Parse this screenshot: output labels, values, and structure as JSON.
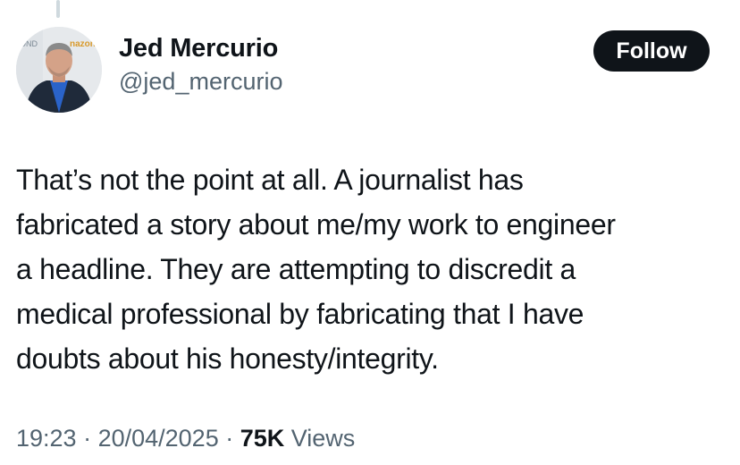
{
  "author": {
    "display_name": "Jed Mercurio",
    "handle": "@jed_mercurio",
    "avatar": "avatar-photo",
    "avatar_backdrop_text": [
      "YOND",
      "nazon"
    ]
  },
  "follow_button": {
    "label": "Follow"
  },
  "tweet": {
    "text": "That’s not the point at all. A journalist has\nfabricated a story about me/my work to engineer\na headline. They are attempting to discredit a\nmedical professional by fabricating that I have\ndoubts about his honesty/integrity."
  },
  "meta": {
    "time": "19:23",
    "separator": " · ",
    "date": "20/04/2025",
    "views_count": "75K",
    "views_label": " Views"
  },
  "colors": {
    "text": "#0f1419",
    "secondary": "#536471",
    "button_bg": "#0f1419",
    "button_text": "#ffffff"
  }
}
